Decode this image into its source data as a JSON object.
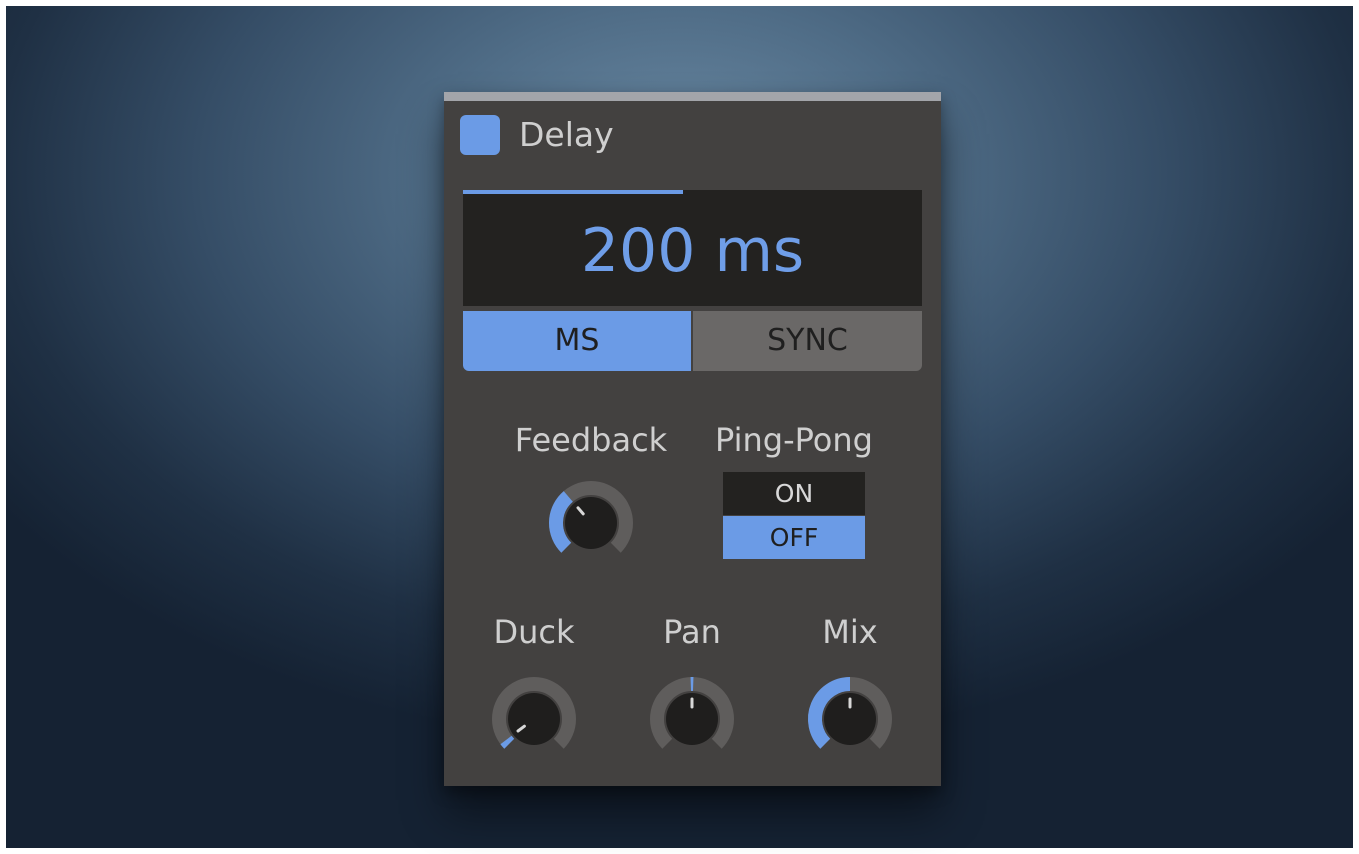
{
  "panel": {
    "title": "Delay",
    "enabled": true,
    "accent_color": "#6b9be6"
  },
  "time_display": {
    "value": "200 ms",
    "progress": 0.48
  },
  "mode": {
    "ms_label": "MS",
    "sync_label": "SYNC",
    "selected": "MS"
  },
  "feedback": {
    "label": "Feedback",
    "value": 0.35
  },
  "ping_pong": {
    "label": "Ping-Pong",
    "on_label": "ON",
    "off_label": "OFF",
    "selected": "OFF"
  },
  "duck": {
    "label": "Duck",
    "value": 0.03
  },
  "pan": {
    "label": "Pan",
    "value": 0.5
  },
  "mix": {
    "label": "Mix",
    "value": 0.5
  }
}
